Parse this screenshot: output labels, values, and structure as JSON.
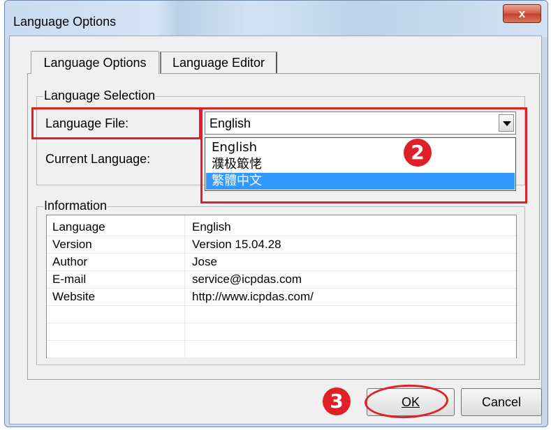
{
  "window": {
    "title": "Language Options",
    "close_label": "x"
  },
  "tabs": [
    {
      "label": "Language Options",
      "active": true
    },
    {
      "label": "Language Editor",
      "active": false
    }
  ],
  "language_selection": {
    "legend": "Language Selection",
    "file_label": "Language File:",
    "current_label": "Current Language:",
    "selected_value": "English",
    "dropdown_options": [
      "English",
      "濮极箃恅",
      "繁體中文"
    ],
    "highlighted_option": 2
  },
  "information": {
    "legend": "Information",
    "rows": [
      {
        "key": "Language",
        "value": "English"
      },
      {
        "key": "Version",
        "value": "Version 15.04.28"
      },
      {
        "key": "Author",
        "value": "Jose"
      },
      {
        "key": "E-mail",
        "value": "service@icpdas.com"
      },
      {
        "key": "Website",
        "value": "http://www.icpdas.com/"
      }
    ]
  },
  "buttons": {
    "ok": "OK",
    "cancel": "Cancel"
  },
  "annotations": {
    "step2": "2",
    "step3": "3",
    "color": "#e01f26"
  }
}
